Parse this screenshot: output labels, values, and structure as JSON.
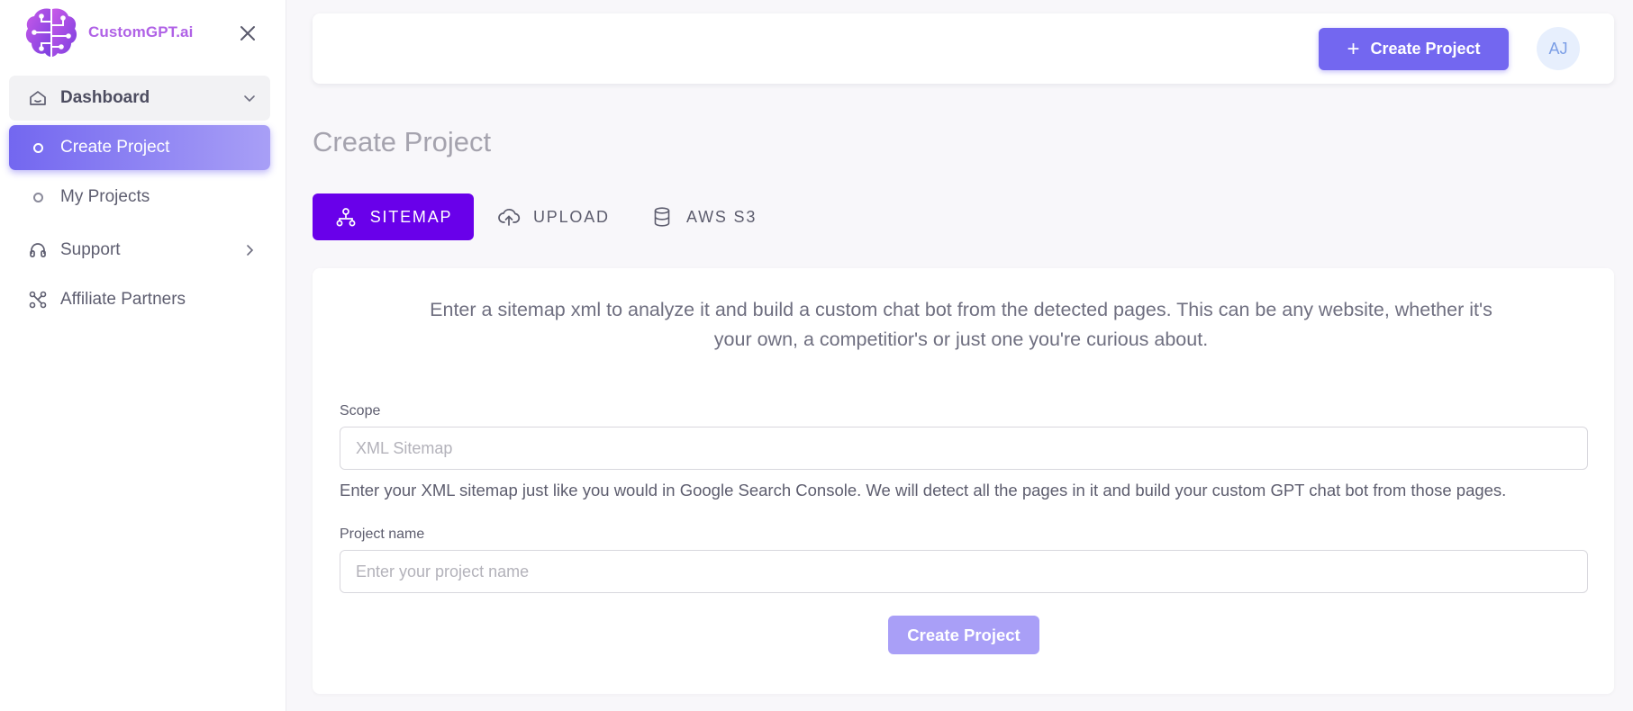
{
  "brand": {
    "name": "CustomGPT.ai",
    "logo_icon": "brain-circuit-icon"
  },
  "sidebar": {
    "close_icon": "close-icon",
    "items": [
      {
        "label": "Dashboard",
        "icon": "home-icon",
        "expanded": true
      },
      {
        "label": "Create Project",
        "icon": "circle-icon",
        "active": true
      },
      {
        "label": "My Projects",
        "icon": "circle-icon"
      },
      {
        "label": "Support",
        "icon": "headphones-icon",
        "expanded": false
      },
      {
        "label": "Affiliate Partners",
        "icon": "share-icon"
      }
    ]
  },
  "header": {
    "create_button_label": "Create Project",
    "avatar_initials": "AJ"
  },
  "page": {
    "title": "Create Project"
  },
  "tabs": [
    {
      "label": "SITEMAP",
      "icon": "sitemap-icon",
      "active": true
    },
    {
      "label": "UPLOAD",
      "icon": "cloud-upload-icon"
    },
    {
      "label": "AWS S3",
      "icon": "database-icon"
    }
  ],
  "form": {
    "intro": "Enter a sitemap xml to analyze it and build a custom chat bot from the detected pages. This can be any website, whether it's your own, a competitior's or just one you're curious about.",
    "scope_label": "Scope",
    "scope_placeholder": "XML Sitemap",
    "scope_help": "Enter your XML sitemap just like you would in Google Search Console. We will detect all the pages in it and build your custom GPT chat bot from those pages.",
    "project_name_label": "Project name",
    "project_name_placeholder": "Enter your project name",
    "submit_label": "Create Project"
  },
  "colors": {
    "primary": "#7367f0",
    "tab_active": "#6900ea",
    "brand_text": "#b062e6",
    "submit_disabled": "#a99ff7"
  }
}
